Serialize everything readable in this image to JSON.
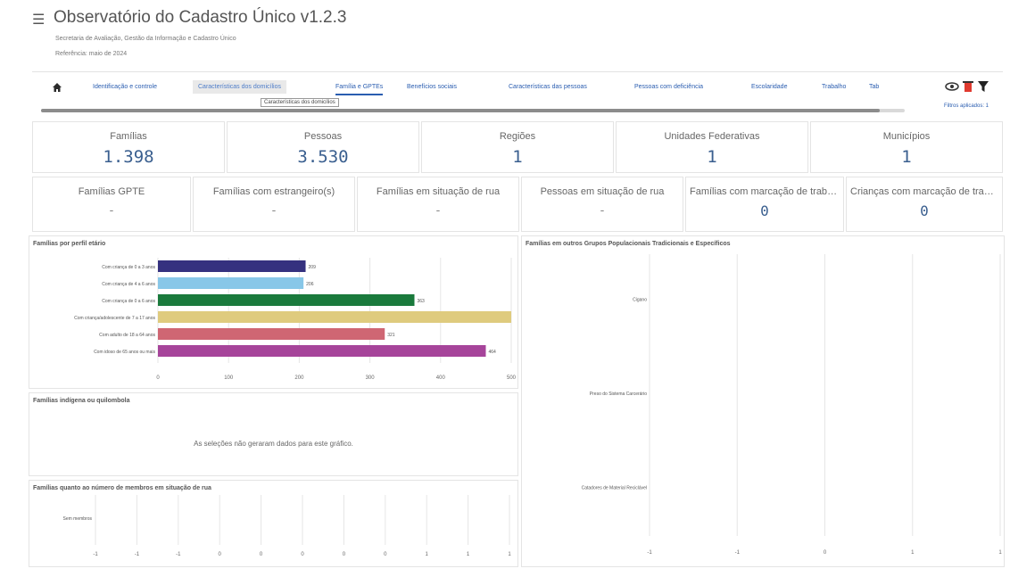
{
  "header": {
    "title": "Observatório do Cadastro Único v1.2.3",
    "subtitle": "Secretaria de Avaliação, Gestão da Informação e Cadastro Único",
    "reference": "Referência: maio de 2024",
    "menu_icon": "hamburger-icon"
  },
  "tabs": [
    {
      "label": "Identificação e controle"
    },
    {
      "label": "Características dos domicílios"
    },
    {
      "label": "Família e GPTEs"
    },
    {
      "label": "Benefícios sociais"
    },
    {
      "label": "Características das pessoas"
    },
    {
      "label": "Pessoas com deficiência"
    },
    {
      "label": "Escolaridade"
    },
    {
      "label": "Trabalho"
    },
    {
      "label": "Tab"
    }
  ],
  "active_tab_tooltip": "Características dos domicílios",
  "filters_link": "Filtros aplicados: 1",
  "icons": {
    "home": "home-icon",
    "eye": "eye-icon",
    "trash": "trash-icon",
    "filter": "filter-icon"
  },
  "colors": {
    "accent": "#2a5db0",
    "kpi_value": "#3a5f8f",
    "trash": "#e03a2f"
  },
  "kpis_row1": [
    {
      "label": "Famílias",
      "value": "1.398"
    },
    {
      "label": "Pessoas",
      "value": "3.530"
    },
    {
      "label": "Regiões",
      "value": "1"
    },
    {
      "label": "Unidades Federativas",
      "value": "1"
    },
    {
      "label": "Municípios",
      "value": "1"
    }
  ],
  "kpis_row2": [
    {
      "label": "Famílias GPTE",
      "value": "-"
    },
    {
      "label": "Famílias com estrangeiro(s)",
      "value": "-"
    },
    {
      "label": "Famílias em situação de rua",
      "value": "-"
    },
    {
      "label": "Pessoas em situação de rua",
      "value": "-"
    },
    {
      "label": "Famílias com marcação de trabal...",
      "value": "0"
    },
    {
      "label": "Crianças com marcação de traba...",
      "value": "0"
    }
  ],
  "panel_perfil": {
    "title": "Famílias por perfil etário"
  },
  "panel_indigena": {
    "title": "Famílias indígena ou quilombola",
    "message": "As seleções não geraram dados para este gráfico."
  },
  "panel_rua": {
    "title": "Famílias quanto ao número de membros em situação de rua"
  },
  "panel_grupos": {
    "title": "Famílias em outros Grupos Populacionais Tradicionais e Específicos"
  },
  "chart_data": [
    {
      "type": "bar",
      "orientation": "horizontal",
      "title": "Famílias por perfil etário",
      "categories": [
        "Com criança de 0 a 3 anos",
        "Com criança de 4 a 6 anos",
        "Com criança de 0 a 6 anos",
        "Com criança/adolescente de 7 a 17 anos",
        "Com adulto de 18 a 64 anos",
        "Com idoso de 65 anos ou mais"
      ],
      "values": [
        209,
        206,
        363,
        1000,
        321,
        464
      ],
      "data_labels": [
        "209",
        "206",
        "363",
        "",
        "321",
        "464"
      ],
      "xlim": [
        0,
        500
      ],
      "x_ticks": [
        "0",
        "100",
        "200",
        "300",
        "400",
        "500"
      ],
      "colors": [
        "#35317f",
        "#88c7e8",
        "#1a7a3c",
        "#dfcb7e",
        "#cf6673",
        "#a6449a"
      ],
      "grid": true
    },
    {
      "type": "bar",
      "orientation": "horizontal",
      "title": "Famílias quanto ao número de membros em situação de rua",
      "categories": [
        "Sem membros"
      ],
      "values": [
        0
      ],
      "x_ticks": [
        "-1",
        "-1",
        "-1",
        "0",
        "0",
        "0",
        "0",
        "0",
        "1",
        "1",
        "1"
      ],
      "grid": true
    },
    {
      "type": "bar",
      "orientation": "horizontal",
      "title": "Famílias em outros Grupos Populacionais Tradicionais e Específicos",
      "categories": [
        "Cigano",
        "Preso do Sistema Carcerário",
        "Catadores de Material Reciclável"
      ],
      "values": [
        0,
        0,
        0
      ],
      "x_ticks": [
        "-1",
        "-1",
        "0",
        "1",
        "1"
      ],
      "grid": true
    }
  ]
}
